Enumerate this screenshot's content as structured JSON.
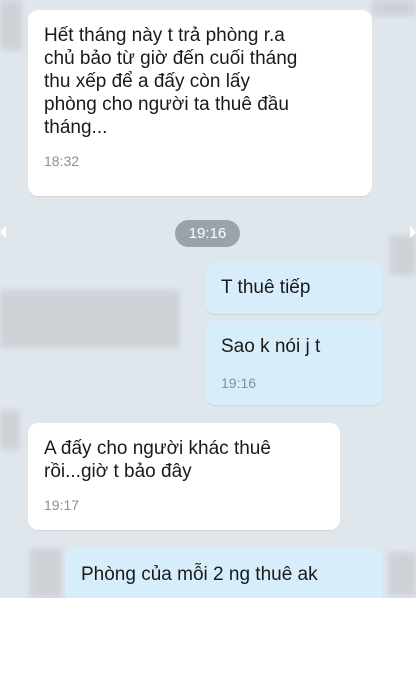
{
  "messages": [
    {
      "direction": "in",
      "text": "Hết tháng này t trả phòng r.a\nchủ bảo từ giờ đến cuối tháng\nthu xếp để a đấy còn lấy\nphòng cho người ta thuê đầu\ntháng...",
      "time": "18:32"
    },
    {
      "direction": "out",
      "text": "T thuê tiếp",
      "time": ""
    },
    {
      "direction": "out",
      "text": "Sao k nói j t",
      "time": "19:16"
    },
    {
      "direction": "in",
      "text": "A đấy cho người khác thuê\nrồi...giờ t bảo đây",
      "time": "19:17"
    },
    {
      "direction": "out",
      "text": "Phòng của mỗi 2 ng thuê ak",
      "time": ""
    }
  ],
  "date_separator": "19:16"
}
